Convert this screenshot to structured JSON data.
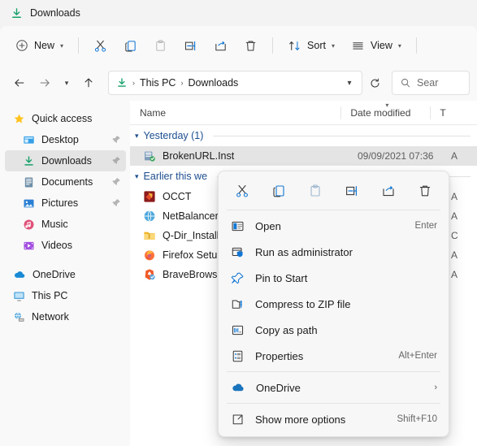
{
  "window": {
    "title": "Downloads",
    "title_icon": "downloads-arrow-icon"
  },
  "toolbar": {
    "new_label": "New",
    "sort_label": "Sort",
    "view_label": "View",
    "buttons": [
      {
        "name": "cut-button",
        "icon": "scissors-icon"
      },
      {
        "name": "copy-button",
        "icon": "copy-icon"
      },
      {
        "name": "paste-button",
        "icon": "paste-icon"
      },
      {
        "name": "rename-button",
        "icon": "rename-icon"
      },
      {
        "name": "share-button",
        "icon": "share-icon"
      },
      {
        "name": "delete-button",
        "icon": "trash-icon"
      }
    ]
  },
  "address": {
    "back_icon": "arrow-left-icon",
    "forward_icon": "arrow-right-icon",
    "recent_icon": "chevron-down-icon",
    "up_icon": "arrow-up-icon",
    "crumb_icon": "downloads-arrow-icon",
    "crumbs": [
      "This PC",
      "Downloads"
    ],
    "separator": "›",
    "refresh_icon": "refresh-icon",
    "dropdown_icon": "chevron-down-icon"
  },
  "search": {
    "placeholder": "Sear",
    "icon": "search-icon"
  },
  "sidebar": {
    "items": [
      {
        "label": "Quick access",
        "icon": "star-icon",
        "indent": false,
        "pinned": false,
        "selected": false
      },
      {
        "label": "Desktop",
        "icon": "desktop-icon",
        "indent": true,
        "pinned": true,
        "selected": false
      },
      {
        "label": "Downloads",
        "icon": "downloads-arrow-icon",
        "indent": true,
        "pinned": true,
        "selected": true
      },
      {
        "label": "Documents",
        "icon": "documents-icon",
        "indent": true,
        "pinned": true,
        "selected": false
      },
      {
        "label": "Pictures",
        "icon": "pictures-icon",
        "indent": true,
        "pinned": true,
        "selected": false
      },
      {
        "label": "Music",
        "icon": "music-icon",
        "indent": true,
        "pinned": false,
        "selected": false
      },
      {
        "label": "Videos",
        "icon": "videos-icon",
        "indent": true,
        "pinned": false,
        "selected": false
      },
      {
        "label": "OneDrive",
        "icon": "cloud-icon",
        "indent": false,
        "pinned": false,
        "selected": false
      },
      {
        "label": "This PC",
        "icon": "monitor-icon",
        "indent": false,
        "pinned": false,
        "selected": false
      },
      {
        "label": "Network",
        "icon": "network-icon",
        "indent": false,
        "pinned": false,
        "selected": false
      }
    ]
  },
  "filelist": {
    "columns": {
      "name": "Name",
      "date_modified": "Date modified",
      "type": "T"
    },
    "groups": [
      {
        "label": "Yesterday (1)",
        "files": [
          {
            "name": "BrokenURL.Inst",
            "date": "09/09/2021 07:36",
            "type": "A",
            "icon": "msi-installer-icon",
            "selected": true
          }
        ]
      },
      {
        "label": "Earlier this we",
        "files": [
          {
            "name": "OCCT",
            "date": "",
            "type": "A",
            "icon": "occt-icon",
            "selected": false
          },
          {
            "name": "NetBalancerSe",
            "date": "",
            "type": "A",
            "icon": "globe-icon",
            "selected": false
          },
          {
            "name": "Q-Dir_Installer",
            "date": "",
            "type": "C",
            "icon": "folder-zip-icon",
            "selected": false
          },
          {
            "name": "Firefox Setup 9",
            "date": "",
            "type": "A",
            "icon": "firefox-icon",
            "selected": false
          },
          {
            "name": "BraveBrowserS",
            "date": "",
            "type": "A",
            "icon": "brave-icon",
            "selected": false
          }
        ]
      }
    ]
  },
  "context_menu": {
    "icon_row": [
      {
        "name": "cut-menu-button",
        "icon": "scissors-icon"
      },
      {
        "name": "copy-menu-button",
        "icon": "copy-icon"
      },
      {
        "name": "paste-menu-button",
        "icon": "paste-icon"
      },
      {
        "name": "rename-menu-button",
        "icon": "rename-icon"
      },
      {
        "name": "share-menu-button",
        "icon": "share-icon"
      },
      {
        "name": "delete-menu-button",
        "icon": "trash-icon"
      }
    ],
    "items": [
      {
        "label": "Open",
        "accel": "Enter",
        "icon": "window-icon",
        "arrow": false
      },
      {
        "label": "Run as administrator",
        "accel": "",
        "icon": "shield-icon",
        "arrow": false
      },
      {
        "label": "Pin to Start",
        "accel": "",
        "icon": "pin-icon",
        "arrow": false
      },
      {
        "label": "Compress to ZIP file",
        "accel": "",
        "icon": "zip-folder-icon",
        "arrow": false
      },
      {
        "label": "Copy as path",
        "accel": "",
        "icon": "copy-path-icon",
        "arrow": false
      },
      {
        "label": "Properties",
        "accel": "Alt+Enter",
        "icon": "properties-icon",
        "arrow": false
      },
      {
        "label": "OneDrive",
        "accel": "",
        "icon": "cloud-icon",
        "arrow": true
      },
      {
        "label": "Show more options",
        "accel": "Shift+F10",
        "icon": "more-options-icon",
        "arrow": false
      }
    ]
  },
  "colors": {
    "accent_blue": "#0a6ed1",
    "group_blue": "#1d4e8f",
    "download_green": "#14a06a",
    "selection_gray": "#e4e4e4"
  }
}
